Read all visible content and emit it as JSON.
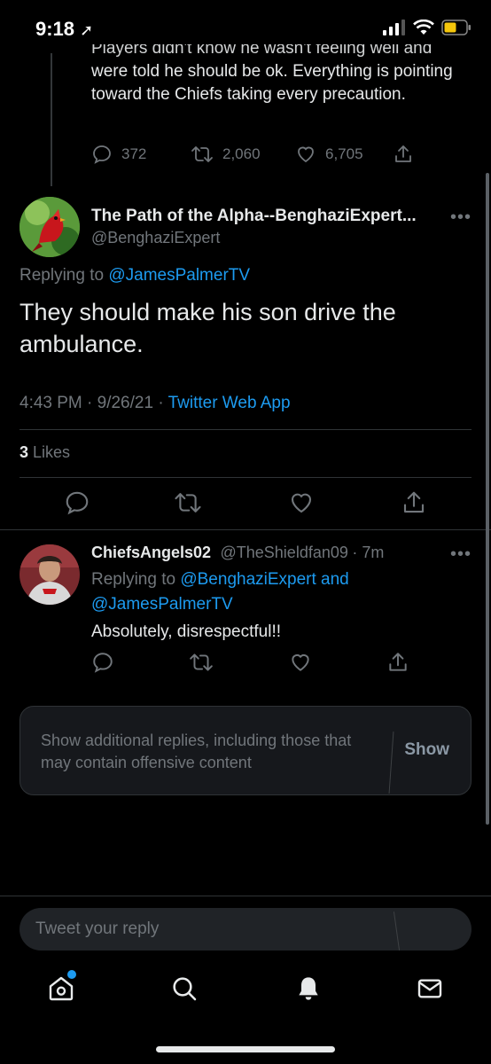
{
  "status_bar": {
    "time": "9:18"
  },
  "previous_tweet": {
    "text_cut": "Players didn't know he wasn't feeling well and",
    "text": "were told he should be ok. Everything is pointing toward the Chiefs taking every precaution.",
    "replies": "372",
    "retweets": "2,060",
    "likes": "6,705"
  },
  "main_tweet": {
    "display_name": "The Path of the Alpha--BenghaziExpert...",
    "handle": "@BenghaziExpert",
    "replying_prefix": "Replying to",
    "replying_to": "@JamesPalmerTV",
    "text": "They should make his son drive the ambulance.",
    "time": "4:43 PM · 9/26/21 · ",
    "source": "Twitter Web App",
    "like_count": "3",
    "like_label": "Likes"
  },
  "reply_tweet": {
    "display_name": "ChiefsAngels02",
    "handle": "@TheShieldfan09",
    "age": "· 7m",
    "replying_prefix": "Replying to",
    "replying_to": "@BenghaziExpert and @JamesPalmerTV",
    "text": "Absolutely, disrespectful!!"
  },
  "additional_replies": {
    "text": "Show additional replies, including those that may contain offensive content",
    "button": "Show"
  },
  "compose": {
    "placeholder": "Tweet your reply"
  },
  "tabs": [
    "home-icon",
    "search-icon",
    "notifications-icon",
    "messages-icon"
  ],
  "colors": {
    "accent": "#1d9bf0",
    "background": "#000000",
    "muted": "#71767b"
  }
}
